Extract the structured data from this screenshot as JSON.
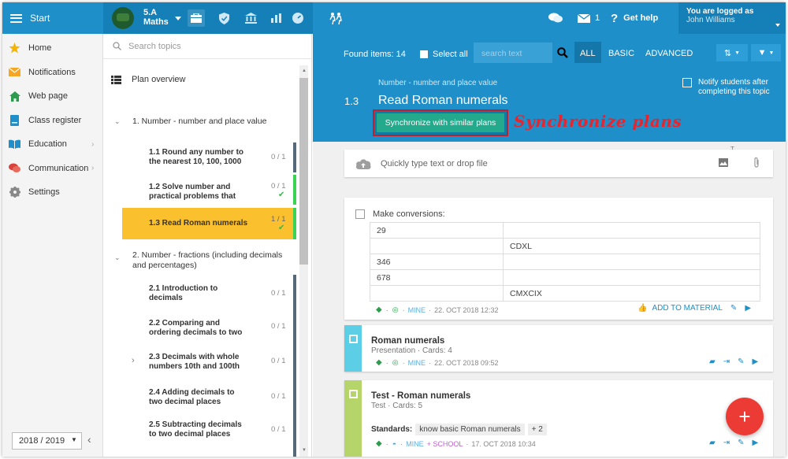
{
  "topbar": {
    "start_label": "Start",
    "class_name": "5.A",
    "subject": "Maths",
    "chat_count": "",
    "mail_count": "1",
    "help_label": "Get help",
    "logged_label": "You are logged as",
    "user_name": "John Williams"
  },
  "sidebar": {
    "items": [
      {
        "label": "Home",
        "icon": "star-icon",
        "color": "#f5b400"
      },
      {
        "label": "Notifications",
        "icon": "mail-icon",
        "color": "#f5a623"
      },
      {
        "label": "Web page",
        "icon": "house-icon",
        "color": "#2e9b4e"
      },
      {
        "label": "Class register",
        "icon": "register-icon",
        "color": "#1e8fc8"
      },
      {
        "label": "Education",
        "icon": "book-icon",
        "color": "#1e8fc8"
      },
      {
        "label": "Communication",
        "icon": "chat-icon",
        "color": "#d9413a"
      },
      {
        "label": "Settings",
        "icon": "gear-icon",
        "color": "#888888"
      }
    ],
    "year": "2018 / 2019"
  },
  "topics": {
    "search_placeholder": "Search topics",
    "plan_overview": "Plan overview",
    "unit1": "1. Number - number and place value",
    "items1": [
      {
        "line1": "1.1 Round any number to",
        "line2": "the nearest 10, 100, 1000",
        "count": "0 / 1"
      },
      {
        "line1": "1.2 Solve number and",
        "line2": "practical problems that",
        "count": "0 / 1"
      },
      {
        "line1": "1.3 Read Roman numerals",
        "line2": "",
        "count": "1 / 1"
      }
    ],
    "unit2_line1": "2. Number - fractions (including decimals",
    "unit2_line2": "and percentages)",
    "items2": [
      {
        "line1": "2.1 Introduction to",
        "line2": "decimals",
        "count": "0 / 1"
      },
      {
        "line1": "2.2 Comparing and",
        "line2": "ordering decimals to two",
        "count": "0 / 1"
      },
      {
        "line1": "2.3 Decimals with whole",
        "line2": "numbers 10th and 100th",
        "count": "0 / 1"
      },
      {
        "line1": "2.4 Adding decimals to",
        "line2": "two decimal places",
        "count": "0 / 1"
      },
      {
        "line1": "2.5 Subtracting decimals",
        "line2": "to two decimal places",
        "count": "0 / 1"
      }
    ]
  },
  "main": {
    "found": "Found items: 14",
    "select_all": "Select all",
    "search_placeholder": "search text",
    "tabs": [
      "ALL",
      "BASIC",
      "ADVANCED"
    ],
    "subtitle": "Number - number and place value",
    "number": "1.3",
    "title": "Read Roman numerals",
    "notify_line1": "Notify students after",
    "notify_line2": "completing this topic",
    "sync_button": "Synchronize with similar plans",
    "annotation": "Synchronize plans",
    "upload_placeholder": "Quickly type text or drop file",
    "tiny_text": "T...",
    "conversions": {
      "header": "Make conversions:",
      "rows": [
        [
          "29",
          ""
        ],
        [
          "",
          "CDXL"
        ],
        [
          "346",
          ""
        ],
        [
          "678",
          ""
        ],
        [
          "",
          "CMXCIX"
        ]
      ],
      "owner": "MINE",
      "date": "22. OCT 2018 12:32",
      "add_label": "ADD TO MATERIAL"
    },
    "materials": [
      {
        "title": "Roman numerals",
        "sub": "Presentation · Cards: 4",
        "owner": "MINE",
        "date": "22. OCT 2018 09:52",
        "color": "#5ccfe6"
      },
      {
        "title": "Test - Roman numerals",
        "sub": "Test · Cards: 5",
        "owner": "MINE",
        "school": "+ SCHOOL",
        "date": "17. OCT 2018 10:34",
        "color": "#b5d56a",
        "standards_label": "Standards:",
        "standard": "know basic Roman numerals",
        "more": "+ 2"
      }
    ],
    "fab": "+"
  }
}
